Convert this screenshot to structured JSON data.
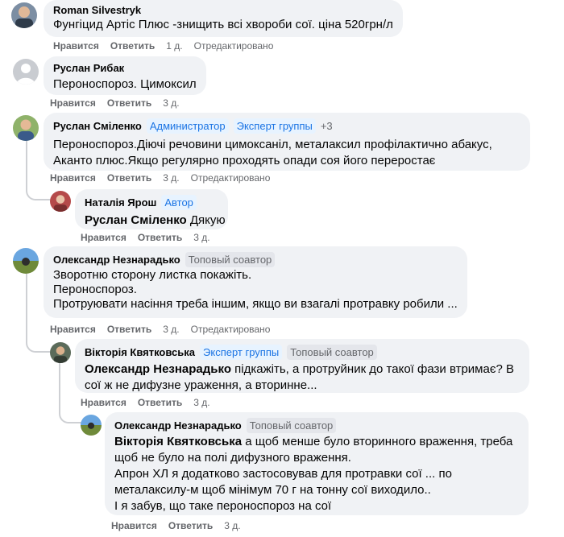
{
  "comments": [
    {
      "author": "Roman Silvestryk",
      "text": "Фунгіцид Артіс Плюс -знищить всі хвороби сої. ціна 520грн/л",
      "like": "Нравится",
      "reply": "Ответить",
      "time": "1 д.",
      "edited": "Отредактировано"
    },
    {
      "author": "Руслан Рибак",
      "text": "Пероноспороз. Цимоксил",
      "like": "Нравится",
      "reply": "Ответить",
      "time": "3 д."
    },
    {
      "author": "Руслан Сміленко",
      "badges": [
        "Администратор",
        "Эксперт группы"
      ],
      "more": "+3",
      "lines": [
        "Пероноспороз.Діючі речовини цимоксаніл, металаксил профілактично абакус,",
        "Аканто плюс.Якщо регулярно проходять опади соя його переростає"
      ],
      "like": "Нравится",
      "reply": "Ответить",
      "time": "3 д.",
      "edited": "Отредактировано"
    },
    {
      "author": "Наталія Ярош",
      "badges": [
        "Автор"
      ],
      "mention": "Руслан Сміленко",
      "text": " Дякую",
      "like": "Нравится",
      "reply": "Ответить",
      "time": "3 д."
    },
    {
      "author": "Олександр Незнарадько",
      "badges": [
        "Топовый соавтор"
      ],
      "lines": [
        "Зворотню сторону листка покажіть.",
        "Пероноспороз.",
        "Протруювати насіння треба іншим, якщо ви взагалі протравку робили ..."
      ],
      "like": "Нравится",
      "reply": "Ответить",
      "time": "3 д.",
      "edited": "Отредактировано"
    },
    {
      "author": "Вікторія Квятковська",
      "badges": [
        "Эксперт группы",
        "Топовый соавтор"
      ],
      "mention": "Олександр Незнарадько",
      "line1_rest": " підкажіть, а протруйник до такої фази втримає? В",
      "line2": "сої ж не дифузне ураження, а вторинне...",
      "like": "Нравится",
      "reply": "Ответить",
      "time": "3 д."
    },
    {
      "author": "Олександр Незнарадько",
      "badges": [
        "Топовый соавтор"
      ],
      "mention": "Вікторія Квятковська",
      "line1_rest": " а щоб менше було вторинного враження, треба",
      "lines": [
        "щоб не було на полі дифузного враження.",
        "Апрон ХЛ я додатково застосовував для протравки сої ... по",
        "металаксилу-м щоб мінімум 70 г на тонну сої виходило..",
        "І я забув, що таке пероноспороз на сої"
      ],
      "like": "Нравится",
      "reply": "Ответить",
      "time": "3 д."
    }
  ]
}
